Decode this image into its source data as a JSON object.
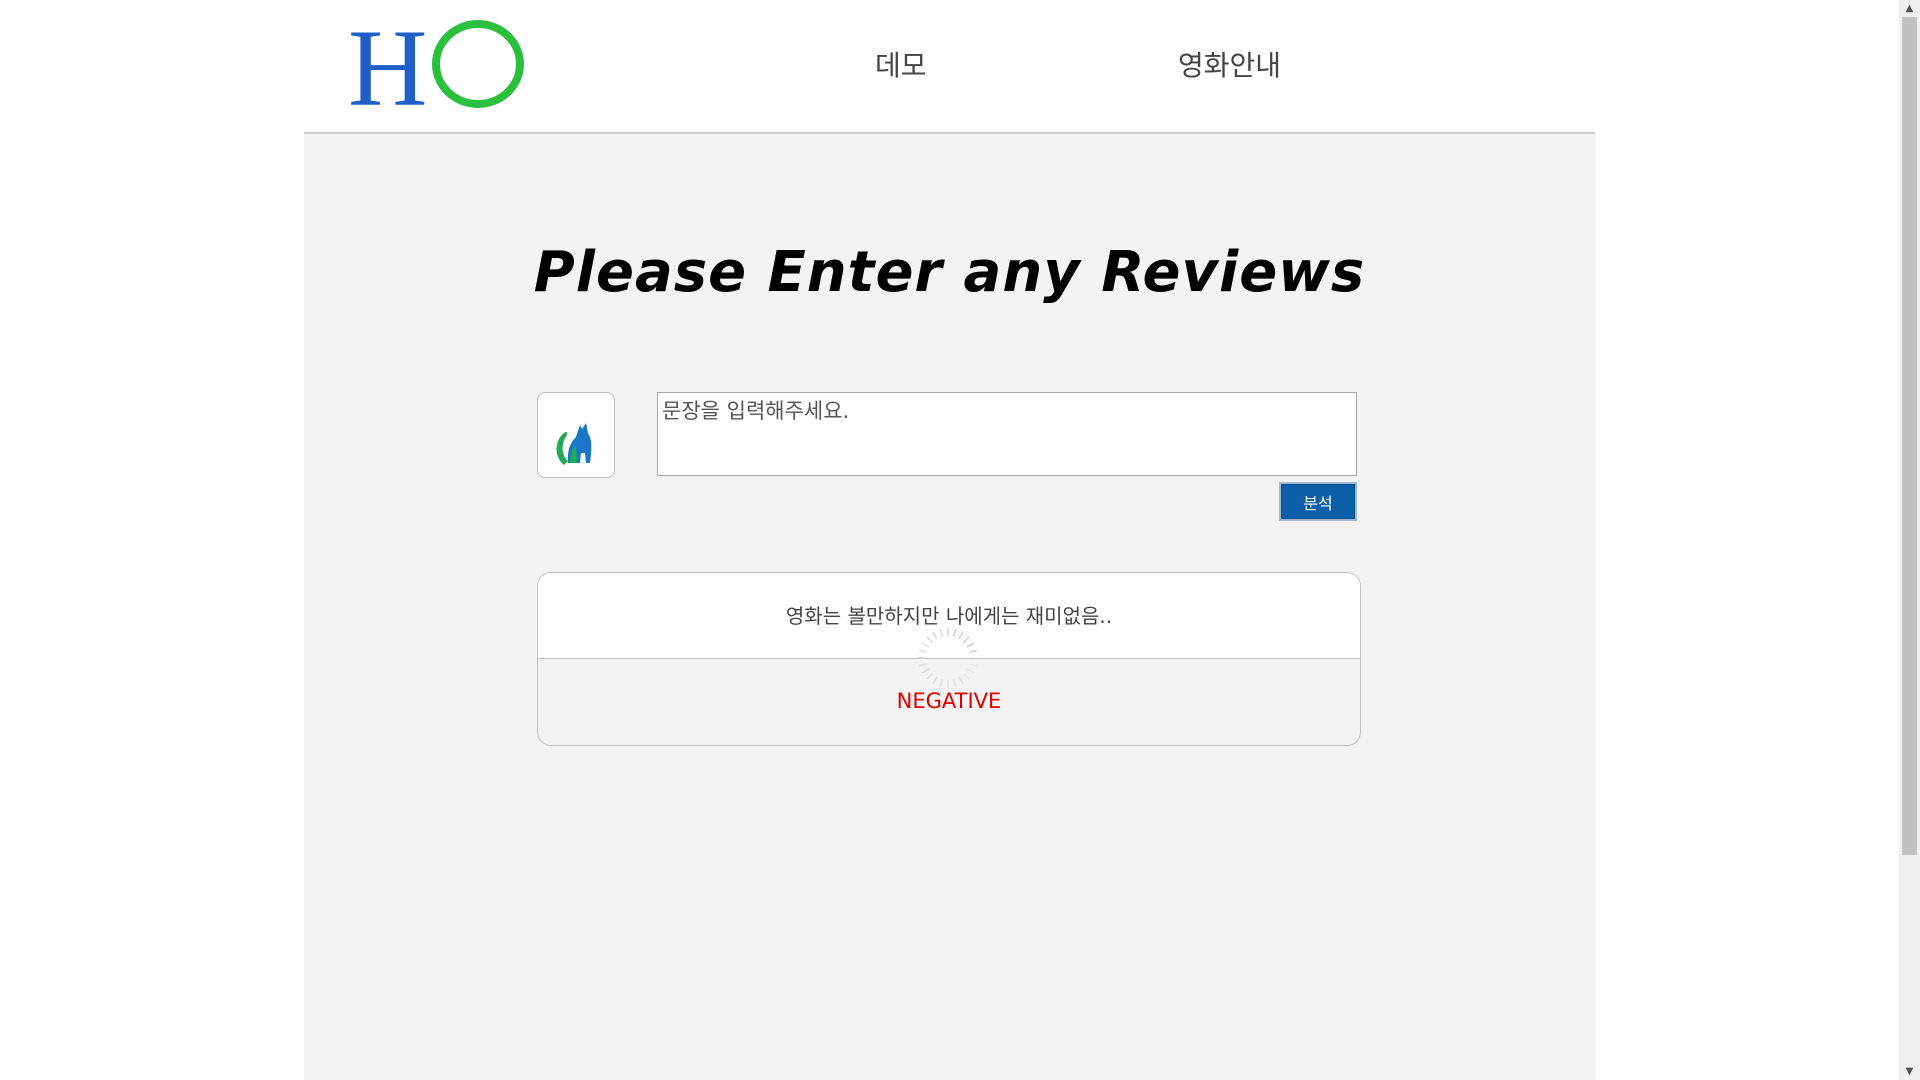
{
  "header": {
    "logo": {
      "letter_h": "H",
      "letter_o": "O",
      "color_h": "#1e5fc7",
      "color_o": "#2bbf3e"
    },
    "nav": [
      {
        "label": "데모"
      },
      {
        "label": "영화안내"
      }
    ]
  },
  "main": {
    "title": "Please Enter any Reviews",
    "review_input": {
      "placeholder": "문장을 입력해주세요.",
      "value": ""
    },
    "analyze_button_label": "분석",
    "result": {
      "sentence": "영화는 볼만하지만 나에게는 재미없음..",
      "label": "NEGATIVE",
      "label_color": "#e00000"
    },
    "avatar_icon": "cat-icon",
    "loading_icon": "spinner-icon"
  },
  "colors": {
    "page_bg": "#f3f3f3",
    "header_bg": "#ffffff",
    "button_bg": "#0b5fa8"
  }
}
